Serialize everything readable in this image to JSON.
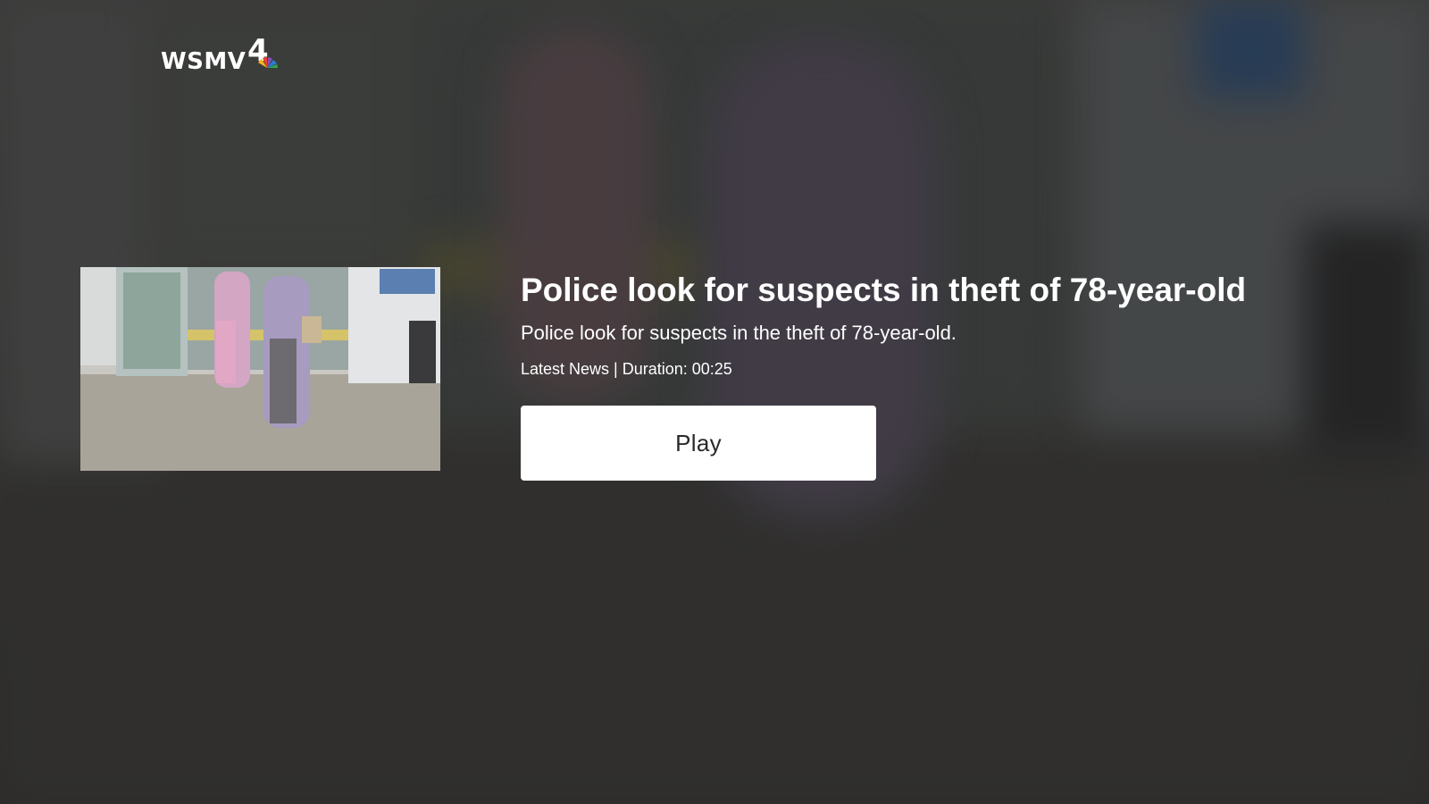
{
  "brand": {
    "logo_text": "WSMV",
    "logo_number": "4",
    "logo_icon": "peacock-icon"
  },
  "video": {
    "title": "Police look for suspects in theft of 78-year-old",
    "description": "Police look for suspects in the theft of 78-year-old.",
    "category": "Latest News",
    "separator": "|",
    "duration_label": "Duration: 00:25",
    "thumbnail_icon": "video-thumbnail"
  },
  "actions": {
    "play_label": "Play"
  },
  "colors": {
    "text": "#ffffff",
    "button_bg": "#ffffff",
    "button_text": "#2a2a2a"
  }
}
